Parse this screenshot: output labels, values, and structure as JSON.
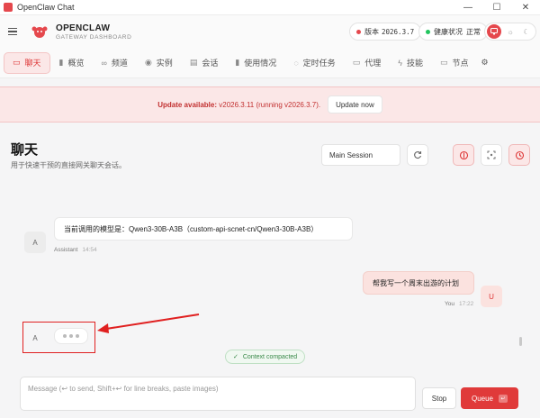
{
  "window": {
    "title": "OpenClaw Chat",
    "min_icon": "—",
    "max_icon": "☐",
    "close_icon": "✕"
  },
  "header": {
    "brand_name": "OPENCLAW",
    "brand_sub": "GATEWAY DASHBOARD",
    "version_label": "版本",
    "version_value": "2026.3.7",
    "health_label": "健康状况",
    "health_value": "正常",
    "status_color": "#22c55e",
    "accent_color": "#e5484d"
  },
  "nav": {
    "items": [
      {
        "label": "聊天",
        "icon": "chat-icon",
        "glyph": "▭",
        "active": true
      },
      {
        "label": "概览",
        "icon": "bar-chart-icon",
        "glyph": "▮"
      },
      {
        "label": "频道",
        "icon": "link-icon",
        "glyph": "∞"
      },
      {
        "label": "实例",
        "icon": "signal-icon",
        "glyph": "◉"
      },
      {
        "label": "会话",
        "icon": "document-icon",
        "glyph": "▤"
      },
      {
        "label": "使用情况",
        "icon": "usage-chart-icon",
        "glyph": "▮"
      },
      {
        "label": "定时任务",
        "icon": "timer-icon",
        "glyph": "◌"
      },
      {
        "label": "代理",
        "icon": "folder-icon",
        "glyph": "▭"
      },
      {
        "label": "技能",
        "icon": "lightning-icon",
        "glyph": "ϟ"
      },
      {
        "label": "节点",
        "icon": "monitor-icon",
        "glyph": "▭"
      }
    ],
    "settings_glyph": "⚙"
  },
  "banner": {
    "prefix": "Update available:",
    "message": " v2026.3.11 (running v2026.3.7).",
    "button_label": "Update now"
  },
  "page": {
    "title": "聊天",
    "subtitle": "用于快速干预的直接网关聊天会话。",
    "session_value": "Main Session"
  },
  "messages": {
    "assistant_avatar": "A",
    "user_avatar": "U",
    "first_text": "当前调用的模型是：Qwen3-30B-A3B（custom-api-scnet-cn/Qwen3-30B-A3B）",
    "first_sender": "Assistant",
    "first_time": "14:54",
    "user_text": "帮我写一个周末出游的计划",
    "user_sender": "You",
    "user_time": "17:22"
  },
  "status": {
    "compacted": "Context compacted",
    "check_glyph": "✓"
  },
  "composer": {
    "placeholder": "Message (↩ to send, Shift+↩ for line breaks, paste images)",
    "stop_label": "Stop",
    "queue_label": "Queue",
    "queue_kb": "↵"
  }
}
